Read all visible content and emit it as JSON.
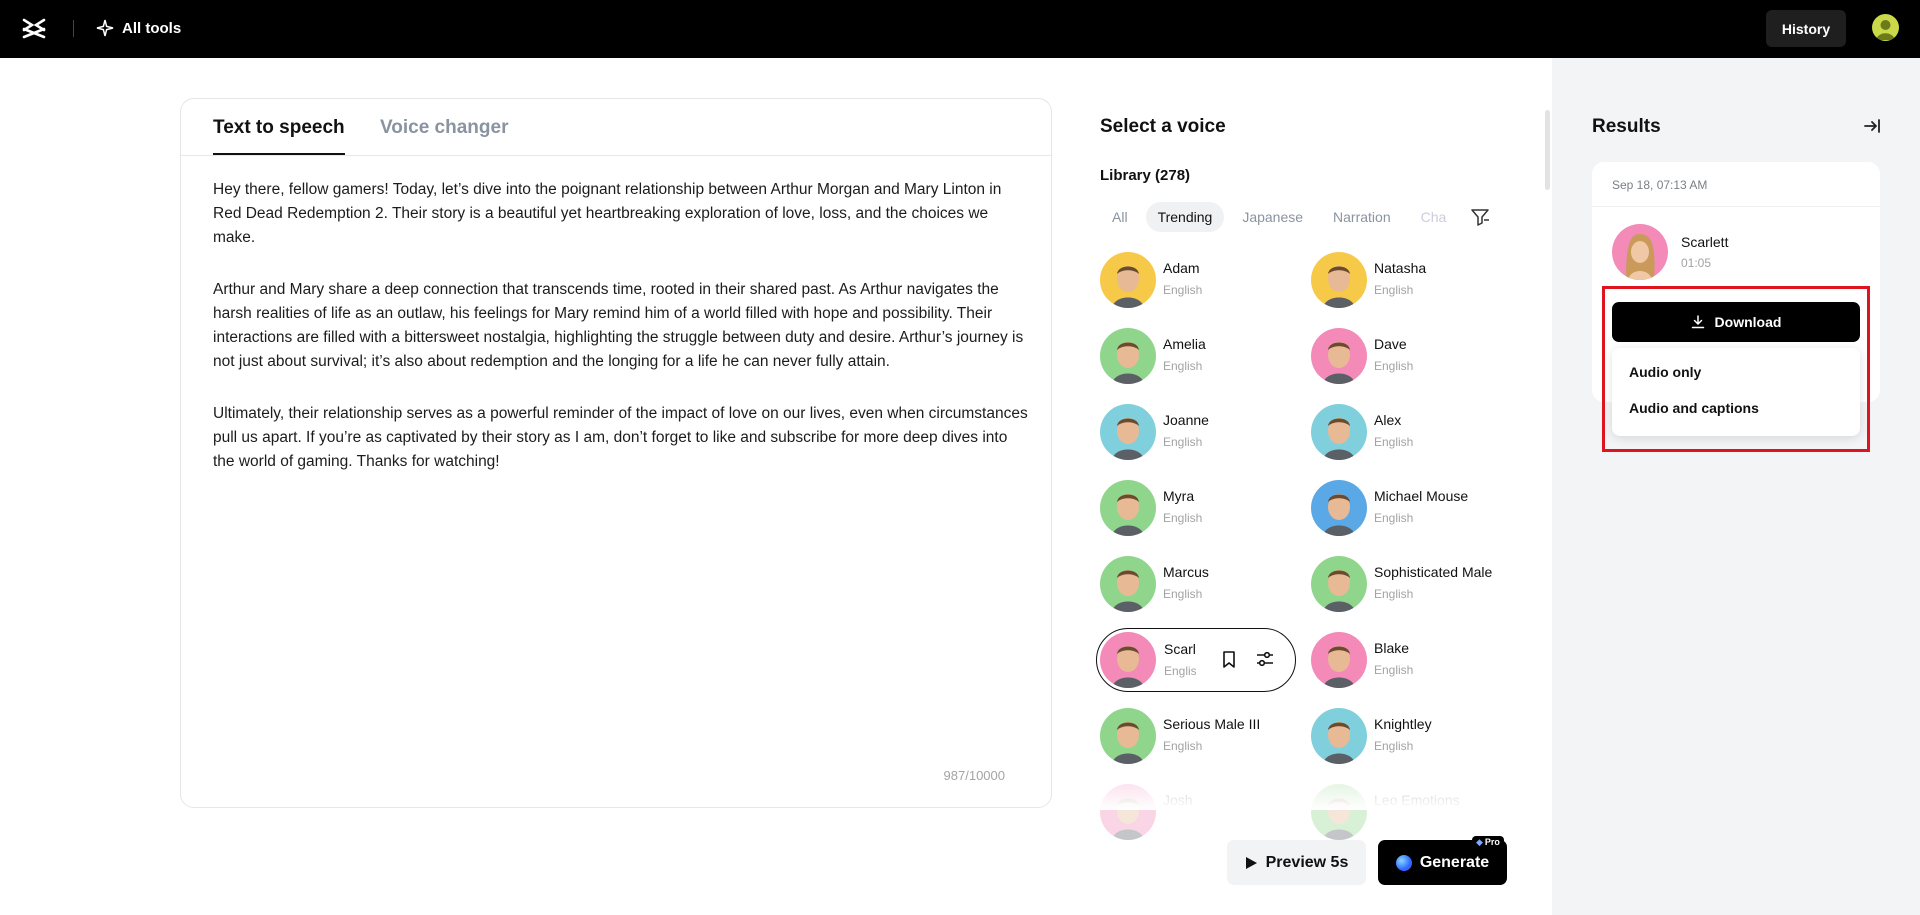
{
  "topbar": {
    "all_tools": "All tools",
    "history": "History"
  },
  "editor": {
    "tab_tts": "Text to speech",
    "tab_vc": "Voice changer",
    "paragraphs": [
      "Hey there, fellow gamers! Today, let’s dive into the poignant relationship between Arthur Morgan and Mary Linton in Red Dead Redemption 2. Their story is a beautiful yet heartbreaking exploration of love, loss, and the choices we make.",
      "Arthur and Mary share a deep connection that transcends time, rooted in their shared past. As Arthur navigates the harsh realities of life as an outlaw, his feelings for Mary remind him of a world filled with hope and possibility. Their interactions are filled with a bittersweet nostalgia, highlighting the struggle between duty and desire. Arthur’s journey is not just about survival; it’s also about redemption and the longing for a life he can never fully attain.",
      "Ultimately, their relationship serves as a powerful reminder of the impact of love on our lives, even when circumstances pull us apart. If you’re as captivated by their story as I am, don’t forget to like and subscribe for more deep dives into the world of gaming. Thanks for watching!"
    ],
    "counter": "987/10000"
  },
  "voice_panel": {
    "title": "Select a voice",
    "library": "Library (278)",
    "filters": [
      "All",
      "Trending",
      "Japanese",
      "Narration",
      "Cha"
    ],
    "active_filter": "Trending",
    "voices": [
      {
        "name": "Adam",
        "lang": "English",
        "bg": "#f7c948"
      },
      {
        "name": "Natasha",
        "lang": "English",
        "bg": "#f7c948"
      },
      {
        "name": "Amelia",
        "lang": "English",
        "bg": "#8fd68c"
      },
      {
        "name": "Dave",
        "lang": "English",
        "bg": "#f38ab8"
      },
      {
        "name": "Joanne",
        "lang": "English",
        "bg": "#7fd0dc"
      },
      {
        "name": "Alex",
        "lang": "English",
        "bg": "#7fd0dc"
      },
      {
        "name": "Myra",
        "lang": "English",
        "bg": "#8fd68c"
      },
      {
        "name": "Michael Mouse",
        "lang": "English",
        "bg": "#5aa9e6"
      },
      {
        "name": "Marcus",
        "lang": "English",
        "bg": "#8fd68c"
      },
      {
        "name": "Sophisticated Male",
        "lang": "English",
        "bg": "#8fd68c"
      },
      {
        "name": "Scarlett",
        "lang": "English",
        "bg": "#f38ab8"
      },
      {
        "name": "Blake",
        "lang": "English",
        "bg": "#f38ab8"
      },
      {
        "name": "Serious Male III",
        "lang": "English",
        "bg": "#8fd68c"
      },
      {
        "name": "Knightley",
        "lang": "English",
        "bg": "#7fd0dc"
      },
      {
        "name": "Josh",
        "lang": "",
        "bg": "#f38ab8"
      },
      {
        "name": "Leo Emotions",
        "lang": "",
        "bg": "#8fd68c"
      }
    ]
  },
  "actions": {
    "preview": "Preview 5s",
    "generate": "Generate",
    "pro": "Pro"
  },
  "results": {
    "title": "Results",
    "date": "Sep 18, 07:13 AM",
    "voice": "Scarlett",
    "duration": "01:05",
    "download": "Download",
    "menu": [
      "Audio only",
      "Audio and captions"
    ]
  }
}
